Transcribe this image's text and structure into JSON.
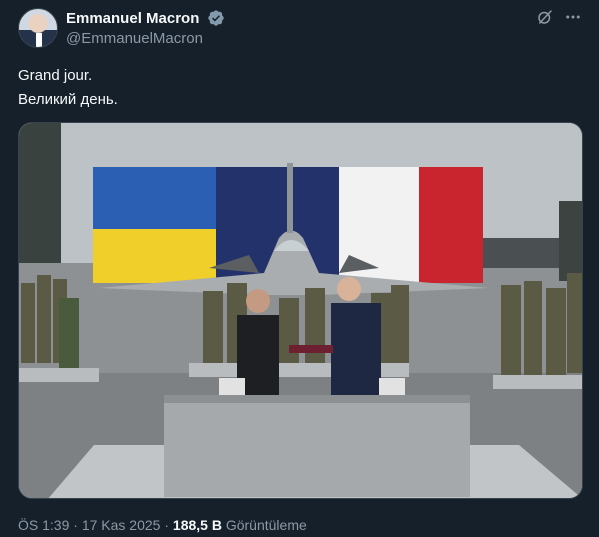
{
  "author": {
    "display_name": "Emmanuel Macron",
    "handle": "@EmmanuelMacron",
    "verified": true
  },
  "tweet": {
    "lines": [
      "Grand jour.",
      "Великий день."
    ]
  },
  "footer": {
    "time": "ÖS 1:39",
    "separator": "·",
    "date": "17 Kas 2025",
    "views": "188,5 B",
    "views_label": "Görüntüleme"
  },
  "icons": {
    "grok": "grok-icon",
    "more": "more-icon",
    "verified": "verified-badge-icon"
  },
  "colors": {
    "background": "#15202b",
    "text": "#f7f9f9",
    "muted": "#8b98a5",
    "verified": "#829aab"
  }
}
